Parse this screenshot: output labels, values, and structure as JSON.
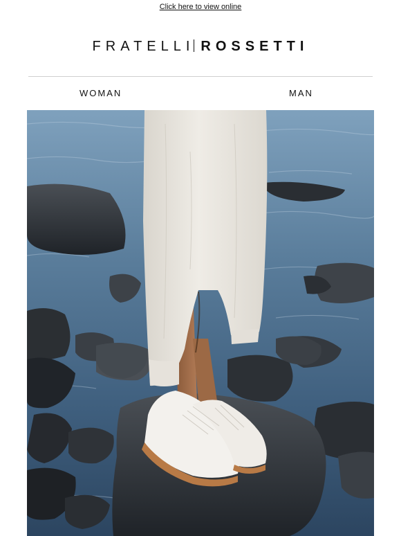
{
  "header": {
    "view_online_label": "Click here to view online",
    "logo": {
      "light_part": "FRATELLI",
      "bold_part": "ROSSETTI"
    }
  },
  "nav": {
    "items": [
      {
        "label": "WOMAN"
      },
      {
        "label": "MAN"
      }
    ]
  },
  "hero": {
    "description_icon": "photo-icon",
    "colors": {
      "water": "#4d6f8f",
      "rock": "#2a2e33",
      "garment": "#ebe8e1",
      "shoe": "#f4f2ee",
      "sole": "#b87a46"
    }
  }
}
